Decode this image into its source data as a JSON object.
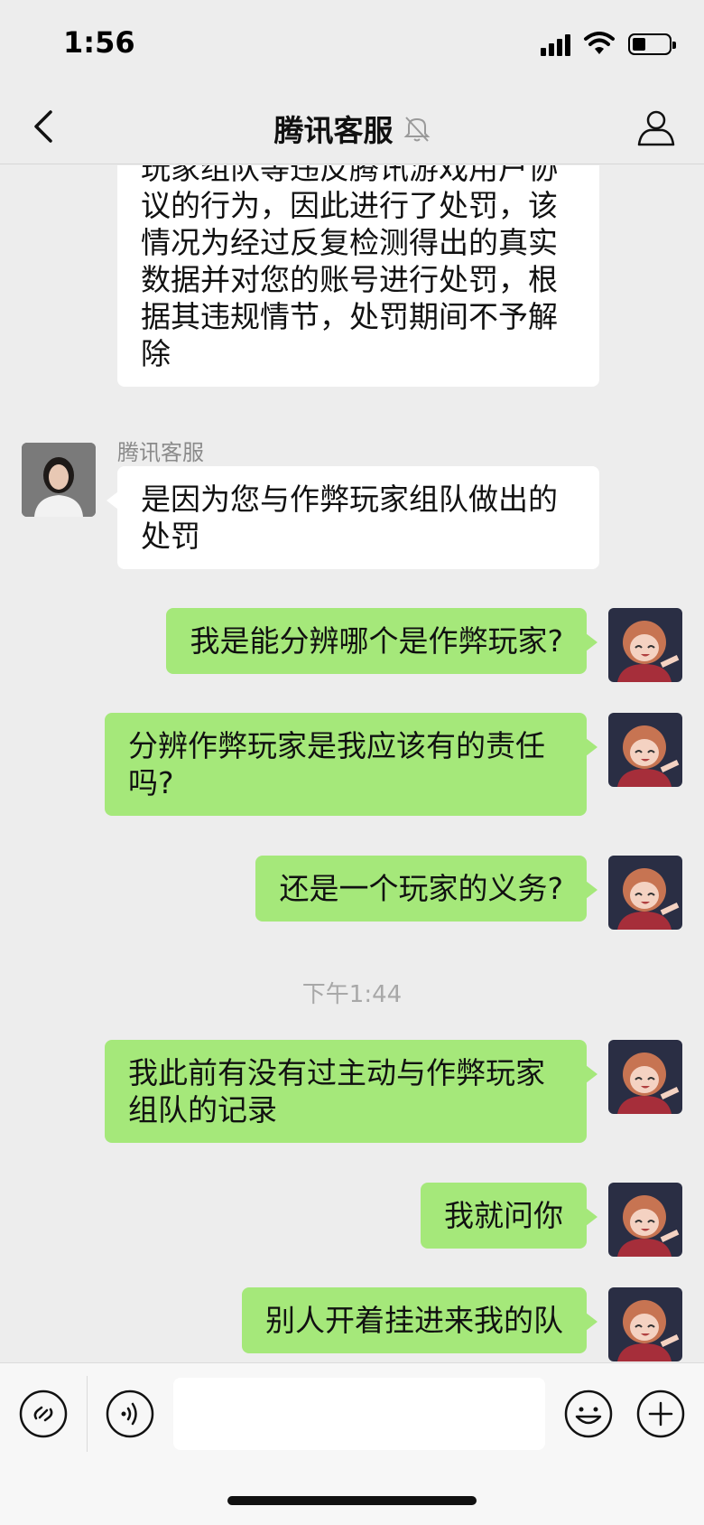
{
  "status_bar": {
    "time": "1:56",
    "battery_level": 0.38
  },
  "nav": {
    "title": "腾讯客服"
  },
  "chat": {
    "agent_name": "腾讯客服",
    "incoming_1": {
      "lines": [
        "玩家组队等违反腾讯游戏用户协",
        "议的行为，因此进行了处罚，该",
        "情况为经过反复检测得出的真实",
        "数据并对您的账号进行处罚，根",
        "据其违规情节，处罚期间不予解",
        "除"
      ]
    },
    "incoming_2": {
      "lines": [
        "是因为您与作弊玩家组队做出的",
        "处罚"
      ]
    },
    "outgoing_1": {
      "lines": [
        "我是能分辨哪个是作弊玩家?"
      ]
    },
    "outgoing_2": {
      "lines": [
        "分辨作弊玩家是我应该有的责任",
        "吗?"
      ]
    },
    "outgoing_3": {
      "lines": [
        "还是一个玩家的义务?"
      ]
    },
    "time_divider": "下午1:44",
    "outgoing_4": {
      "lines": [
        "我此前有没有过主动与作弊玩家",
        "组队的记录"
      ]
    },
    "outgoing_5": {
      "lines": [
        "我就问你"
      ]
    },
    "outgoing_6": {
      "lines": [
        "别人开着挂进来我的队"
      ]
    }
  },
  "input": {
    "value": "",
    "placeholder": ""
  },
  "colors": {
    "background": "#ededed",
    "outgoing_bubble": "#a5e87a",
    "incoming_bubble": "#ffffff",
    "timestamp": "#a8a8a8"
  },
  "icons": {
    "back": "chevron-left-icon",
    "mute": "bell-slash-icon",
    "profile": "person-icon",
    "mini_program": "link-icon",
    "voice": "voice-icon",
    "emoji": "emoji-icon",
    "more": "plus-icon"
  }
}
